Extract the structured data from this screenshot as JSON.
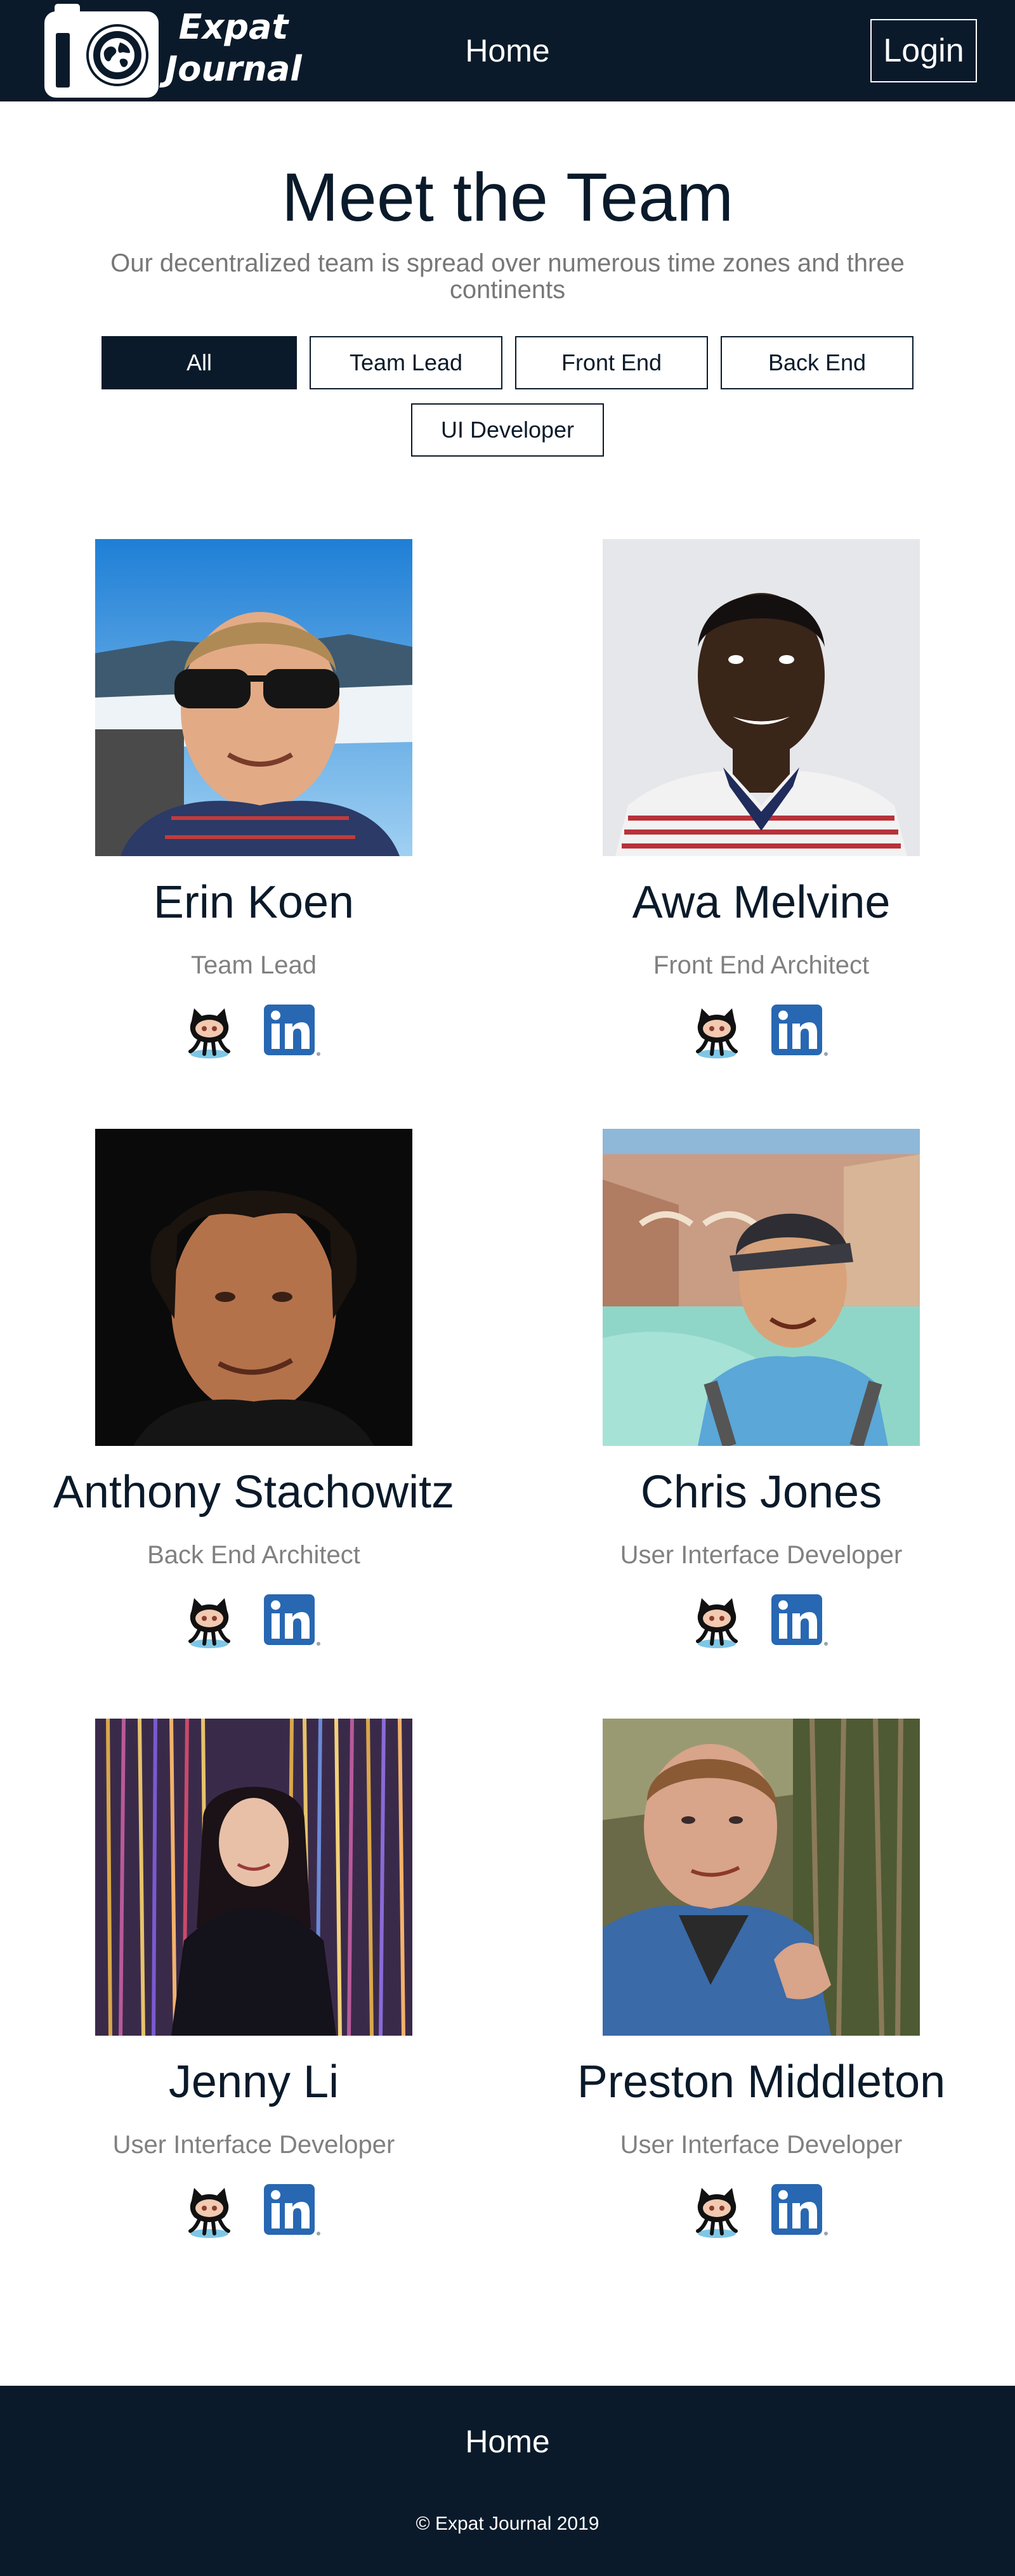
{
  "header": {
    "logo_line1": "Expat",
    "logo_line2": "Journal",
    "nav_home": "Home",
    "login": "Login"
  },
  "hero": {
    "title": "Meet the Team",
    "subtitle": "Our decentralized team is spread over numerous time zones and three continents"
  },
  "filters": [
    {
      "label": "All",
      "active": true
    },
    {
      "label": "Team Lead",
      "active": false
    },
    {
      "label": "Front End",
      "active": false
    },
    {
      "label": "Back End",
      "active": false
    },
    {
      "label": "UI Developer",
      "active": false
    }
  ],
  "team": [
    {
      "name": "Erin Koen",
      "role": "Team Lead"
    },
    {
      "name": "Awa Melvine",
      "role": "Front End Architect"
    },
    {
      "name": "Anthony Stachowitz",
      "role": "Back End Architect"
    },
    {
      "name": "Chris Jones",
      "role": "User Interface Developer"
    },
    {
      "name": "Jenny Li",
      "role": "User Interface Developer"
    },
    {
      "name": "Preston Middleton",
      "role": "User Interface Developer"
    }
  ],
  "footer": {
    "home": "Home",
    "copyright": "© Expat Journal 2019"
  },
  "colors": {
    "navy": "#0a1a2a",
    "muted": "#808080",
    "linkedin": "#2867b2"
  },
  "icons": [
    "github-octocat-icon",
    "linkedin-icon",
    "camera-globe-logo"
  ]
}
